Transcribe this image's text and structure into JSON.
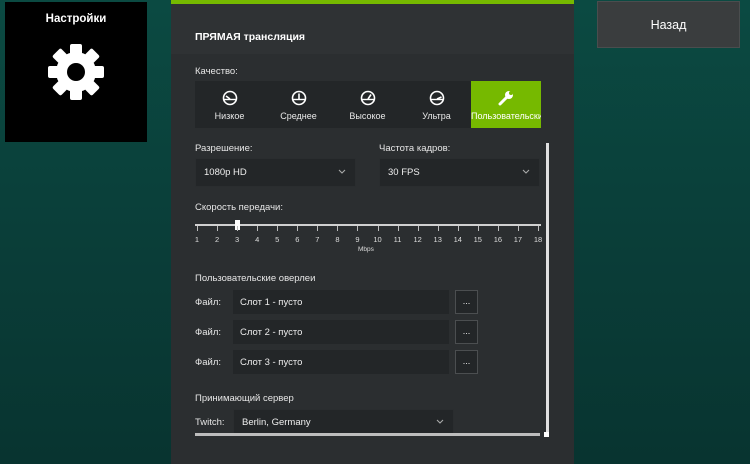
{
  "settings_tile": {
    "title": "Настройки",
    "icon": "gear-icon"
  },
  "back_button": {
    "label": "Назад"
  },
  "panel": {
    "section_title": "ПРЯМАЯ трансляция",
    "accent_color": "#76b900",
    "quality": {
      "label": "Качество:",
      "options": [
        {
          "label": "Низкое",
          "icon": "gauge-low-icon"
        },
        {
          "label": "Среднее",
          "icon": "gauge-medium-icon"
        },
        {
          "label": "Высокое",
          "icon": "gauge-high-icon"
        },
        {
          "label": "Ультра",
          "icon": "gauge-ultra-icon"
        },
        {
          "label": "Пользовательские",
          "icon": "wrench-icon"
        }
      ],
      "selected": "Пользовательские"
    },
    "resolution": {
      "label": "Разрешение:",
      "value": "1080p HD"
    },
    "framerate": {
      "label": "Частота кадров:",
      "value": "30 FPS"
    },
    "bitrate": {
      "label": "Скорость передачи:",
      "ticks": [
        "1",
        "2",
        "3",
        "4",
        "5",
        "6",
        "7",
        "8",
        "9",
        "10",
        "11",
        "12",
        "13",
        "14",
        "15",
        "16",
        "17",
        "18"
      ],
      "unit": "Mbps",
      "value": 3
    },
    "overlays": {
      "title": "Пользовательские оверлеи",
      "rows": [
        {
          "label": "Файл:",
          "value": "Слот 1 - пусто",
          "browse": "..."
        },
        {
          "label": "Файл:",
          "value": "Слот 2 - пусто",
          "browse": "..."
        },
        {
          "label": "Файл:",
          "value": "Слот 3 - пусто",
          "browse": "..."
        }
      ]
    },
    "server": {
      "title": "Принимающий сервер",
      "label": "Twitch:",
      "value": "Berlin, Germany"
    }
  }
}
